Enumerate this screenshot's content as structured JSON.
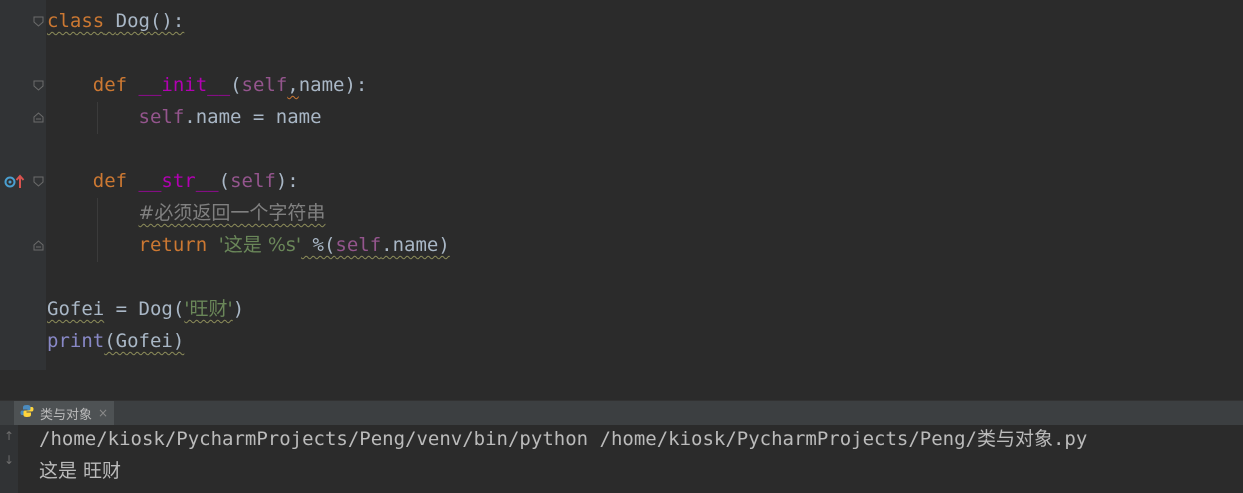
{
  "editor": {
    "lines": {
      "l1": {
        "kw": "class",
        "name": "Dog",
        "rest": "():"
      },
      "l3": {
        "kw": "def",
        "fn": "__init__",
        "p1": "(",
        "self": "self",
        "comma": ",",
        "rest": "name):"
      },
      "l4": {
        "self": "self",
        "rest": ".name = name"
      },
      "l6": {
        "kw": "def",
        "fn": "__str__",
        "p1": "(",
        "self": "self",
        "rest": "):"
      },
      "l7": {
        "comment": "#必须返回一个字符串"
      },
      "l8": {
        "kw": "return",
        "str": "'这是 %s'",
        "op": " %(",
        "self": "self",
        "rest": ".name)"
      },
      "l10": {
        "var": "Gofei",
        "eq": " = Dog(",
        "str": "'旺财'",
        "close": ")"
      },
      "l11": {
        "fn": "print",
        "rest": "(Gofei)"
      }
    }
  },
  "run": {
    "tab_label": "类与对象",
    "close_glyph": "×",
    "output": {
      "command": "/home/kiosk/PycharmProjects/Peng/venv/bin/python /home/kiosk/PycharmProjects/Peng/类与对象.py",
      "result": "这是 旺财"
    },
    "up_arrow": "↑",
    "down_arrow": "↓"
  },
  "colors": {
    "background": "#2b2b2b",
    "keyword": "#cc7832",
    "self": "#94558d",
    "magic": "#b200b2",
    "string": "#6a8759",
    "comment": "#808080",
    "builtin": "#8888c6",
    "text": "#a9b7c6"
  },
  "icons": {
    "override_marker": "override-up-arrow-icon",
    "fold": "fold-marker-icon",
    "python": "python-icon"
  }
}
